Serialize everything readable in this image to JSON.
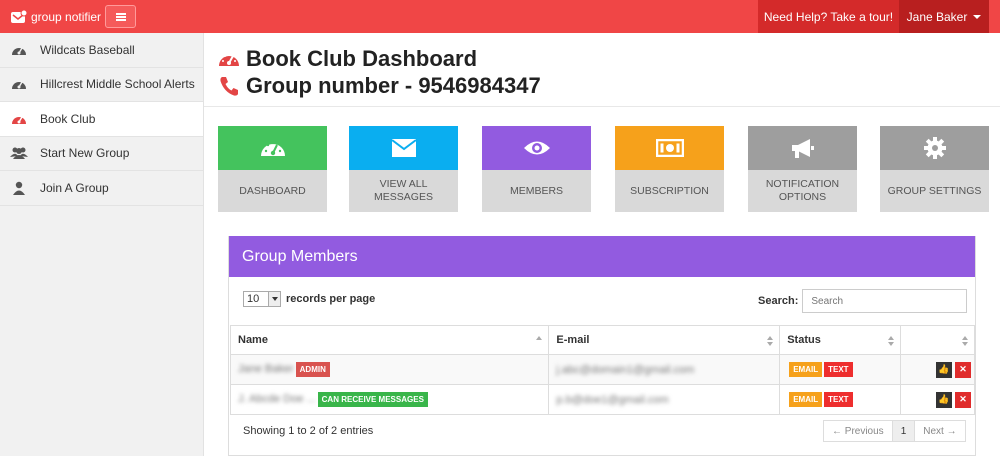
{
  "topbar": {
    "brand": "group notifier",
    "help": "Need Help? Take a tour!",
    "user": "Jane Baker"
  },
  "sidebar": {
    "items": [
      {
        "label": "Wildcats Baseball",
        "icon": "dashboard-icon"
      },
      {
        "label": "Hillcrest Middle School Alerts",
        "icon": "dashboard-icon"
      },
      {
        "label": "Book Club",
        "icon": "dashboard-icon",
        "active": true
      },
      {
        "label": "Start New Group",
        "icon": "users-icon"
      },
      {
        "label": "Join A Group",
        "icon": "user-icon"
      }
    ]
  },
  "header": {
    "title": "Book Club Dashboard",
    "group_number": "Group number - 9546984347"
  },
  "tiles": [
    {
      "label": "DASHBOARD",
      "color": "#44c35d",
      "icon": "dashboard-icon"
    },
    {
      "label": "VIEW ALL MESSAGES",
      "color": "#0aaef0",
      "icon": "envelope-icon"
    },
    {
      "label": "MEMBERS",
      "color": "#925be0",
      "icon": "eye-icon"
    },
    {
      "label": "SUBSCRIPTION",
      "color": "#f6a11b",
      "icon": "money-icon"
    },
    {
      "label": "NOTIFICATION OPTIONS",
      "color": "#9e9e9e",
      "icon": "bullhorn-icon"
    },
    {
      "label": "GROUP SETTINGS",
      "color": "#9e9e9e",
      "icon": "gear-icon"
    }
  ],
  "members_panel": {
    "title": "Group Members",
    "length_value": "10",
    "length_label": "records per page",
    "search_label": "Search:",
    "search_placeholder": "Search",
    "columns": [
      "Name",
      "E-mail",
      "Status",
      ""
    ],
    "rows": [
      {
        "name": "Jane Baker",
        "badge": "ADMIN",
        "email": "j.abc@domain1@gmail.com",
        "status": [
          "EMAIL",
          "TEXT"
        ]
      },
      {
        "name": "J. Abcde Doe ...",
        "badge": "CAN RECEIVE MESSAGES",
        "email": "p.b@doe1@gmail.com",
        "status": [
          "EMAIL",
          "TEXT"
        ]
      }
    ],
    "info": "Showing 1 to 2 of 2 entries",
    "pager": {
      "prev": "← Previous",
      "current": "1",
      "next": "Next →"
    }
  },
  "colors": {
    "topbar": "#f04646",
    "purple": "#925be0",
    "green": "#44c35d",
    "blue": "#0aaef0",
    "orange": "#f6a11b",
    "gray": "#9e9e9e"
  }
}
